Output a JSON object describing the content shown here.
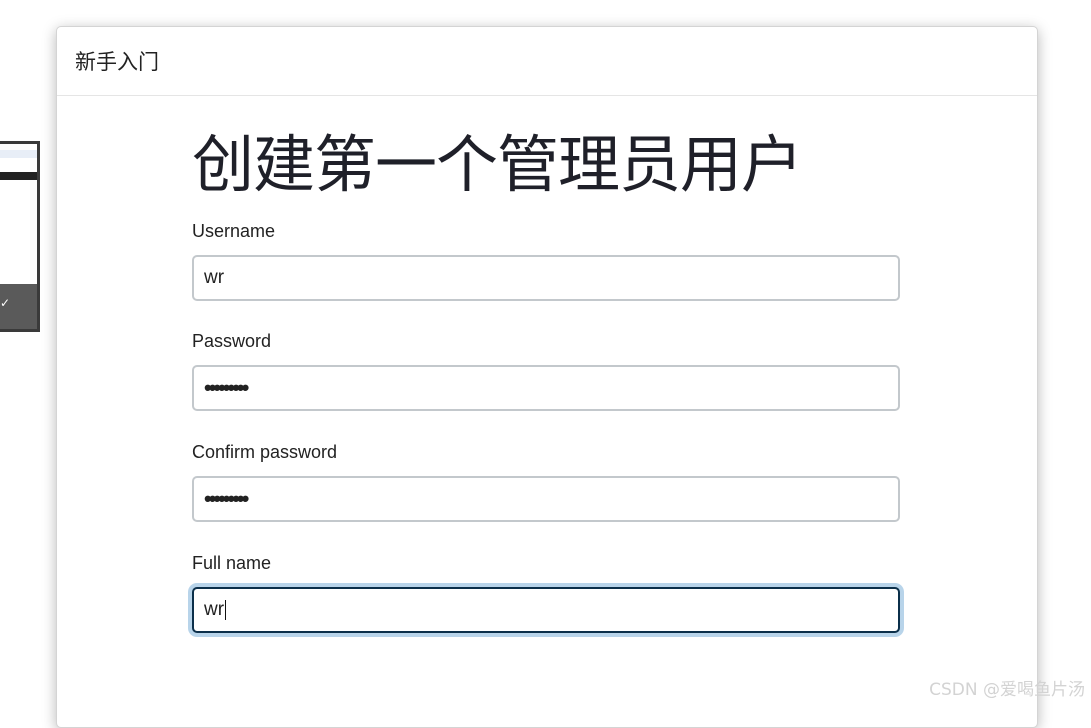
{
  "dialog": {
    "title": "新手入门",
    "heading": "创建第一个管理员用户"
  },
  "form": {
    "username": {
      "label": "Username",
      "value": "wr"
    },
    "password": {
      "label": "Password",
      "value": "•••••••••"
    },
    "confirm_password": {
      "label": "Confirm password",
      "value": "•••••••••"
    },
    "full_name": {
      "label": "Full name",
      "value": "wr",
      "focused": true
    }
  },
  "watermark": "CSDN @爱喝鱼片汤",
  "colors": {
    "focus_border": "#0b2f4a",
    "focus_ring": "#b8d4ea",
    "input_border": "#c3c8cc"
  }
}
